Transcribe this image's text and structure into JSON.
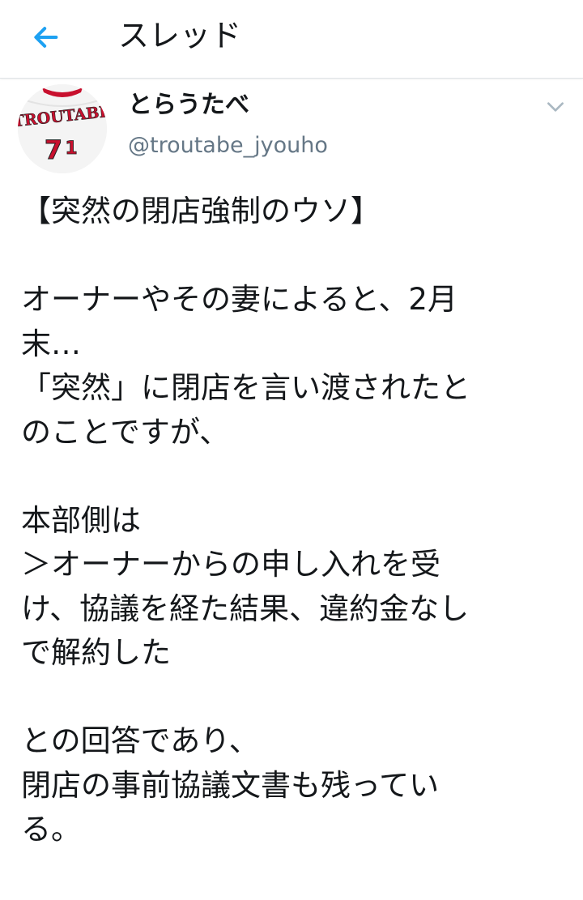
{
  "header": {
    "title": "スレッド"
  },
  "tweet": {
    "author": {
      "display_name": "とらうたべ",
      "handle": "@troutabe_jyouho",
      "avatar": {
        "jersey_text": "TROUTABE",
        "jersey_number_1": "7",
        "jersey_number_2": "1"
      }
    },
    "paragraphs": [
      {
        "lines": [
          "【突然の閉店強制のウソ】"
        ]
      },
      {
        "lines": [
          "オーナーやその妻によると、2月",
          "末…",
          "「突然」に閉店を言い渡されたと",
          "のことですが、"
        ]
      },
      {
        "lines": [
          "本部側は",
          "＞オーナーからの申し入れを受",
          "け、協議を経た結果、違約金なし",
          "で解約した"
        ]
      },
      {
        "lines": [
          "との回答であり、",
          "閉店の事前協議文書も残ってい",
          "る。"
        ]
      }
    ]
  },
  "colors": {
    "accent": "#1da1f2",
    "text": "#14171a",
    "secondary_text": "#657786",
    "jersey_red": "#c8102e"
  },
  "icons": {
    "back": "arrow-left-icon",
    "more": "chevron-down-icon"
  }
}
